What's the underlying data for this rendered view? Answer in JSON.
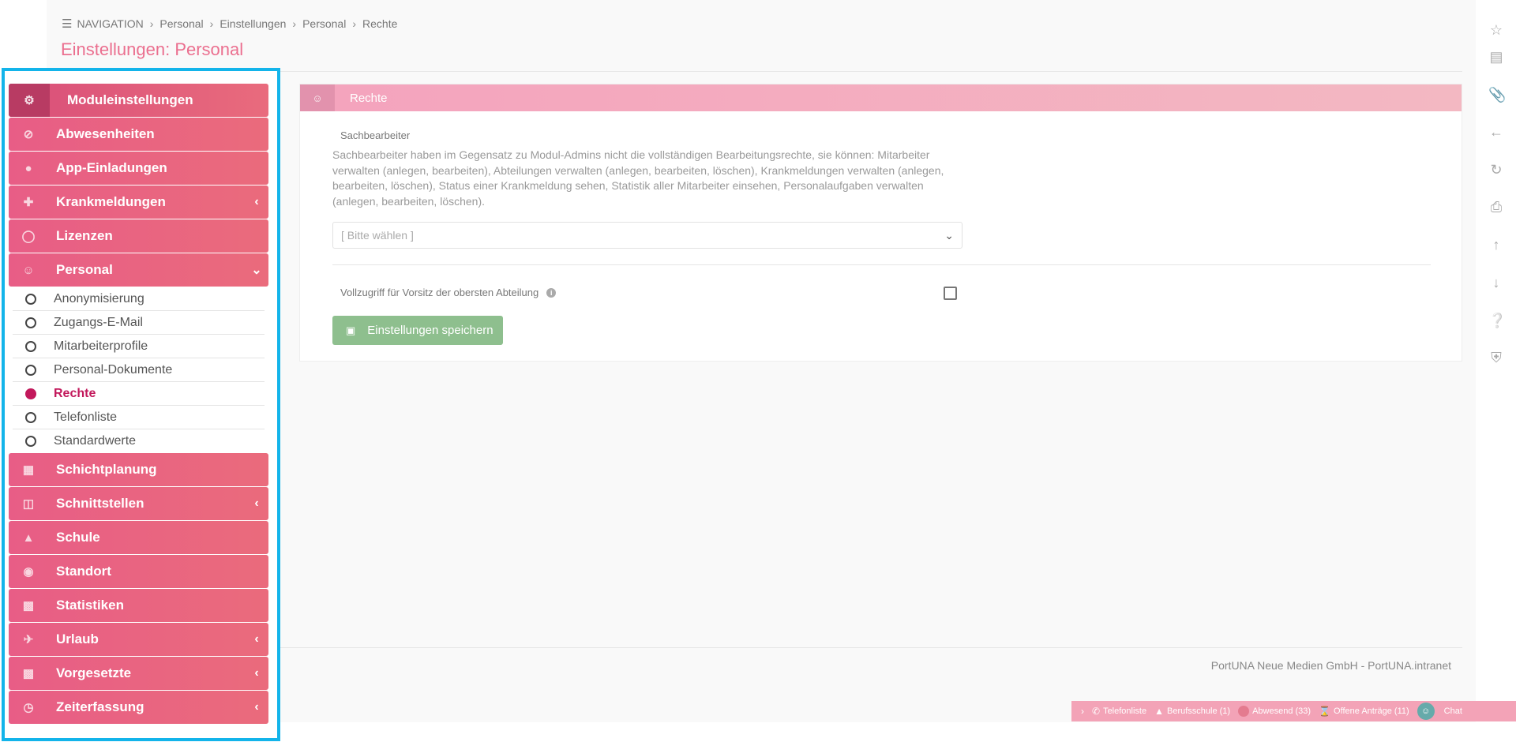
{
  "breadcrumb": {
    "items": [
      "NAVIGATION",
      "Personal",
      "Einstellungen",
      "Personal",
      "Rechte"
    ]
  },
  "page_title": "Einstellungen: Personal",
  "sidebar": {
    "header": "Moduleinstellungen",
    "items": [
      {
        "label": "Abwesenheiten",
        "icon": "ban-icon",
        "expandable": false
      },
      {
        "label": "App-Einladungen",
        "icon": "user-icon",
        "expandable": false
      },
      {
        "label": "Krankmeldungen",
        "icon": "medical-icon",
        "expandable": true
      },
      {
        "label": "Lizenzen",
        "icon": "circle-notch-icon",
        "expandable": false
      },
      {
        "label": "Personal",
        "icon": "users-icon",
        "expandable": true,
        "expanded": true
      }
    ],
    "personal_sub": [
      {
        "label": "Anonymisierung",
        "active": false
      },
      {
        "label": "Zugangs-E-Mail",
        "active": false
      },
      {
        "label": "Mitarbeiterprofile",
        "active": false
      },
      {
        "label": "Personal-Dokumente",
        "active": false
      },
      {
        "label": "Rechte",
        "active": true
      },
      {
        "label": "Telefonliste",
        "active": false
      },
      {
        "label": "Standardwerte",
        "active": false
      }
    ],
    "items_after": [
      {
        "label": "Schichtplanung",
        "icon": "calendar-icon",
        "expandable": false
      },
      {
        "label": "Schnittstellen",
        "icon": "sitemap-icon",
        "expandable": true
      },
      {
        "label": "Schule",
        "icon": "graduation-cap-icon",
        "expandable": false
      },
      {
        "label": "Standort",
        "icon": "map-marker-icon",
        "expandable": false
      },
      {
        "label": "Statistiken",
        "icon": "chart-icon",
        "expandable": false
      },
      {
        "label": "Urlaub",
        "icon": "plane-icon",
        "expandable": true
      },
      {
        "label": "Vorgesetzte",
        "icon": "chart-icon",
        "expandable": true
      },
      {
        "label": "Zeiterfassung",
        "icon": "clock-icon",
        "expandable": true
      }
    ]
  },
  "panel": {
    "title": "Rechte",
    "field_label": "Sachbearbeiter",
    "field_description": "Sachbearbeiter haben im Gegensatz zu Modul-Admins nicht die vollständigen Bearbeitungsrechte, sie können: Mitarbeiter verwalten (anlegen, bearbeiten), Abteilungen verwalten (anlegen, bearbeiten, löschen), Krankmeldungen verwalten (anlegen, bearbeiten, löschen), Status einer Krankmeldung sehen, Statistik aller Mitarbeiter einsehen, Personalaufgaben verwalten (anlegen, bearbeiten, löschen).",
    "select_placeholder": "[ Bitte wählen ]",
    "checkbox_label": "Vollzugriff für Vorsitz der obersten Abteilung",
    "checkbox_checked": false,
    "save_label": "Einstellungen speichern"
  },
  "footer": {
    "text": "PortUNA Neue Medien GmbH - PortUNA.intranet"
  },
  "statusbar": {
    "telefonliste": "Telefonliste",
    "berufsschule": "Berufsschule (1)",
    "abwesend": "Abwesend (33)",
    "offene_antraege": "Offene Anträge (11)",
    "chat": "Chat"
  },
  "colors": {
    "accent": "#e85d86",
    "active": "#c2185b",
    "save_button": "#8ebf8e",
    "highlight_frame": "#13b4ea"
  }
}
